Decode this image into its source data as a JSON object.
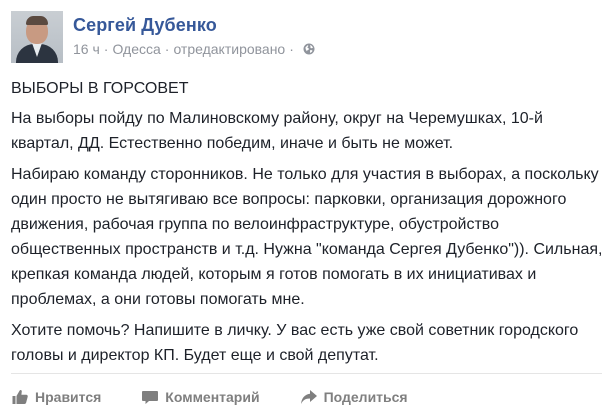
{
  "post": {
    "author": "Сергей Дубенко",
    "time": "16 ч",
    "location": "Одесса",
    "edited": "отредактировано",
    "title": "ВЫБОРЫ В ГОРСОВЕТ",
    "paragraphs": [
      "На выборы пойду по Малиновскому району, округ на Черемушках, 10-й квартал, ДД. Естественно победим, иначе и быть не может.",
      "Набираю команду сторонников. Не только для участия в выборах, а поскольку один просто не вытягиваю все вопросы: парковки, организация дорожного движения, рабочая группа по велоинфраструктуре, обустройство общественных пространств и т.д. Нужна \"команда Сергея Дубенко\")). Сильная, крепкая команда людей, которым я готов помогать в их инициативах и проблемах, а они готовы помогать мне.",
      "Хотите помочь? Напишите в личку. У вас есть уже свой советник городского головы и директор КП. Будет еще и свой депутат."
    ]
  },
  "actions": {
    "like_label": "Нравится",
    "comment_label": "Комментарий",
    "share_label": "Поделиться"
  },
  "icons": {
    "visibility": "globe-icon",
    "like": "thumbs-up-icon",
    "comment": "comment-icon",
    "share": "share-icon"
  },
  "colors": {
    "author_link": "#365899",
    "meta_text": "#90949c",
    "action_text": "#7f7f7f",
    "body_text": "#1d2129"
  }
}
